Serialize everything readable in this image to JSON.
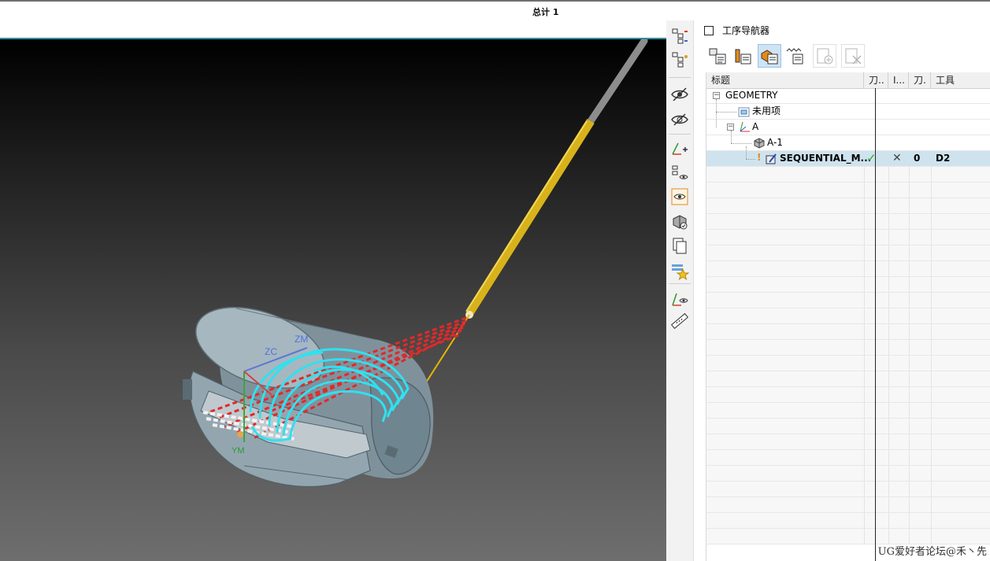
{
  "top": {
    "total_label": "总计 1"
  },
  "navigator": {
    "title": "工序导航器",
    "columns": [
      "标题",
      "刀..",
      "I...",
      "刀.",
      "工具"
    ],
    "rows": [
      {
        "name": "GEOMETRY",
        "icon": "minus-expander"
      },
      {
        "name": "未用项",
        "icon": "folder-icon"
      },
      {
        "name": "A",
        "icon": "mcs-icon"
      },
      {
        "name": "A-1",
        "icon": "workpiece-icon"
      },
      {
        "name": "SEQUENTIAL_M...",
        "icon": "operation-icon",
        "path_status": "✓",
        "io_status": "✕",
        "tool_number": "0",
        "tool": "D2",
        "selected": true
      }
    ]
  },
  "viewport": {
    "label_zc": "ZC",
    "label_zm": "ZM",
    "label_ym": "YM"
  },
  "watermark": "UG爱好者论坛@禾丶先",
  "colors": {
    "toolpath_cyan": "#31e0ef",
    "rapid_red": "#e02a2a",
    "tool_shank": "#d8b21a",
    "part": "#8fa2ad",
    "selection": "#cfe3ee"
  }
}
